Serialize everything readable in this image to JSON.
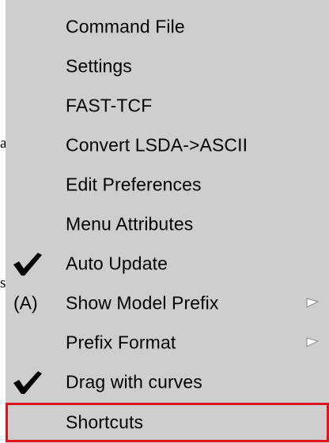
{
  "background_fragments": [
    "a",
    "s"
  ],
  "menu": {
    "items": [
      {
        "label": "Command File",
        "prefix": "",
        "checked": false,
        "submenu": false,
        "highlighted": false
      },
      {
        "label": "Settings",
        "prefix": "",
        "checked": false,
        "submenu": false,
        "highlighted": false
      },
      {
        "label": "FAST-TCF",
        "prefix": "",
        "checked": false,
        "submenu": false,
        "highlighted": false
      },
      {
        "label": "Convert LSDA->ASCII",
        "prefix": "",
        "checked": false,
        "submenu": false,
        "highlighted": false
      },
      {
        "label": "Edit Preferences",
        "prefix": "",
        "checked": false,
        "submenu": false,
        "highlighted": false
      },
      {
        "label": "Menu Attributes",
        "prefix": "",
        "checked": false,
        "submenu": false,
        "highlighted": false
      },
      {
        "label": "Auto Update",
        "prefix": "",
        "checked": true,
        "submenu": false,
        "highlighted": false
      },
      {
        "label": "Show Model Prefix",
        "prefix": "(A)",
        "checked": false,
        "submenu": true,
        "highlighted": false
      },
      {
        "label": "Prefix Format",
        "prefix": "",
        "checked": false,
        "submenu": true,
        "highlighted": false
      },
      {
        "label": "Drag with curves",
        "prefix": "",
        "checked": true,
        "submenu": false,
        "highlighted": false
      },
      {
        "label": "Shortcuts",
        "prefix": "",
        "checked": false,
        "submenu": false,
        "highlighted": true
      }
    ]
  },
  "icons": {
    "check": "checkmark-icon",
    "submenu": "submenu-arrow-icon"
  },
  "colors": {
    "menu_background": "#cecece",
    "highlight_border": "#e0141e",
    "arrow": "#ffffff"
  }
}
